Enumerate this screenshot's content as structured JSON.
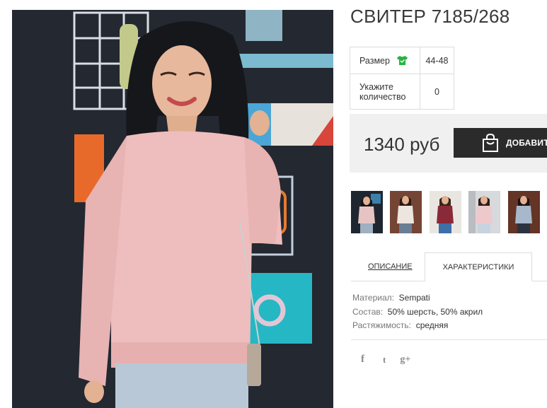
{
  "product": {
    "title": "СВИТЕР 7185/268",
    "price": "1340 руб",
    "add_to_cart_label": "ДОБАВИТЬ"
  },
  "options": {
    "size_label": "Размер",
    "size_value": "44-48",
    "quantity_label": "Укажите количество",
    "quantity_value": "0"
  },
  "thumbnails": [
    {
      "sweater_color": "#e7c4c4"
    },
    {
      "sweater_color": "#ece6df"
    },
    {
      "sweater_color": "#8a2a38"
    },
    {
      "sweater_color": "#eec9cc"
    },
    {
      "sweater_color": "#a8b8cc"
    }
  ],
  "tabs": {
    "description_label": "ОПИСАНИЕ",
    "characteristics_label": "ХАРАКТЕРИСТИКИ"
  },
  "characteristics": [
    {
      "key": "Материал:",
      "value": "Sempati"
    },
    {
      "key": "Состав:",
      "value": "50% шерсть, 50% акрил"
    },
    {
      "key": "Растяжимость:",
      "value": "средняя"
    }
  ],
  "social": {
    "facebook": "f",
    "twitter": "t",
    "googleplus": "g+"
  },
  "colors": {
    "size_icon": "#27b33f",
    "button_bg": "#2b2b2b",
    "buybox_bg": "#f0f0f0"
  }
}
